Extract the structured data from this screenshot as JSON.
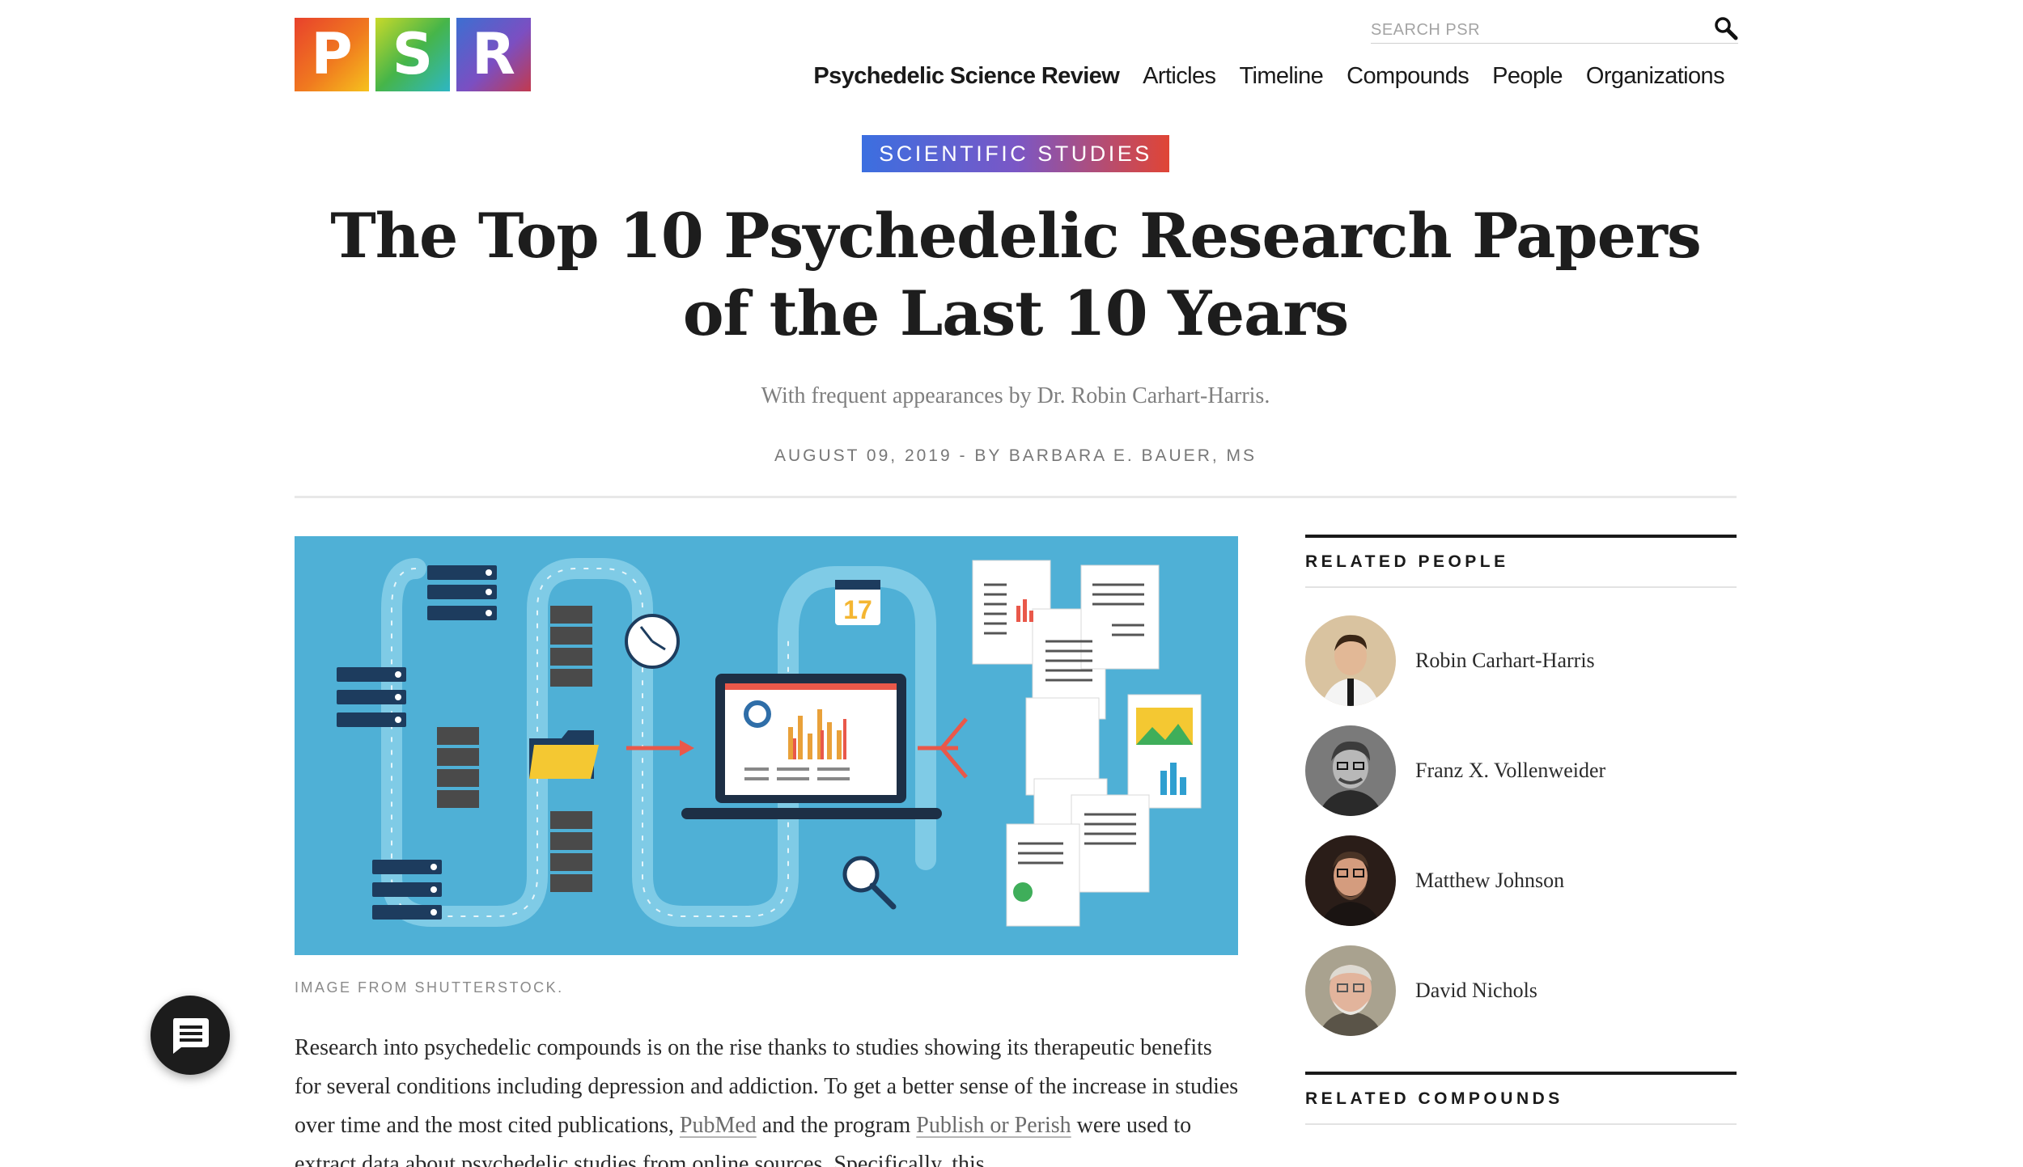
{
  "logo": {
    "letters": [
      "P",
      "S",
      "R"
    ]
  },
  "search": {
    "placeholder": "SEARCH PSR"
  },
  "nav": {
    "brand": "Psychedelic Science Review",
    "items": [
      "Articles",
      "Timeline",
      "Compounds",
      "People",
      "Organizations"
    ]
  },
  "article": {
    "category": "SCIENTIFIC STUDIES",
    "title": "The Top 10 Psychedelic Research Papers of the Last 10 Years",
    "subtitle": "With frequent appearances by Dr. Robin Carhart-Harris.",
    "byline": "AUGUST 09, 2019 - BY BARBARA E. BAUER, MS",
    "image_caption": "IMAGE FROM SHUTTERSTOCK.",
    "hero_calendar_day": "17",
    "body_part1": "Research into psychedelic compounds is on the rise thanks to studies showing its therapeutic benefits for several conditions including depression and addiction. To get a better sense of the increase in studies over time and the most cited publications, ",
    "link_pubmed": "PubMed",
    "body_part2": " and the program ",
    "link_publish": "Publish or Perish",
    "body_part3": " were used to extract data about psychedelic studies from online sources. Specifically, this"
  },
  "sidebar": {
    "related_people_heading": "RELATED PEOPLE",
    "people": [
      {
        "name": "Robin Carhart-Harris"
      },
      {
        "name": "Franz X. Vollenweider"
      },
      {
        "name": "Matthew Johnson"
      },
      {
        "name": "David Nichols"
      }
    ],
    "related_compounds_heading": "RELATED COMPOUNDS"
  },
  "colors": {
    "hero_background": "#4fb0d6",
    "category_gradient": [
      "#3b6fe0",
      "#7a57c6",
      "#e04535"
    ]
  }
}
